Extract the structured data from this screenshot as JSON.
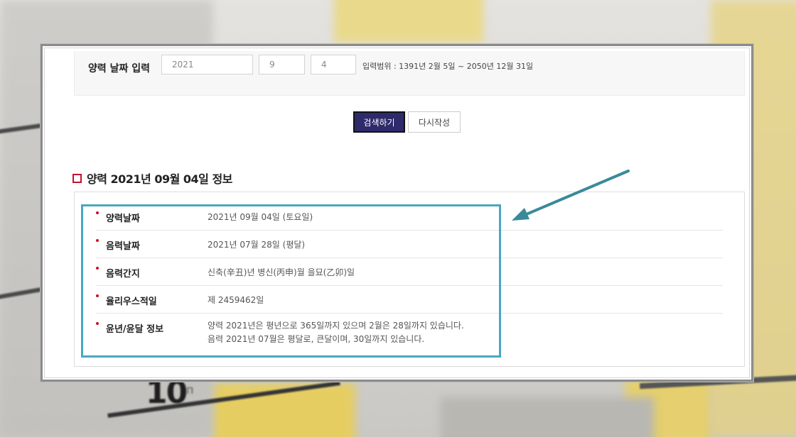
{
  "form": {
    "label": "양력 날짜 입력",
    "year_value": "2021",
    "month_value": "9",
    "day_value": "4",
    "range_text": "입력범위 : 1391년 2월 5일 ~ 2050년 12월 31일"
  },
  "buttons": {
    "search_label": "검색하기",
    "reset_label": "다시작성"
  },
  "section": {
    "title": "양력 2021년 09월 04일 정보"
  },
  "info_rows": [
    {
      "key": "양력날짜",
      "value": "2021년 09월 04일 (토요일)"
    },
    {
      "key": "음력날짜",
      "value": "2021년 07월 28일 (평달)"
    },
    {
      "key": "음력간지",
      "value": "신축(辛丑)년 병신(丙申)월 을묘(乙卯)일"
    },
    {
      "key": "율리우스적일",
      "value": "제 2459462일"
    },
    {
      "key": "윤년/윤달 정보",
      "value": "양력 2021년은 평년으로 365일까지 있으며 2월은 28일까지 있습니다.",
      "value2": "음력 2021년 07월은 평달로, 큰달이며, 30일까지 있습니다."
    }
  ],
  "background_text": {
    "big_number": "10",
    "small_mark": "п"
  },
  "colors": {
    "accent_red": "#c8102e",
    "button_navy": "#2e2a6b",
    "highlight_teal": "#4aa7c0",
    "arrow_teal": "#3a8a9a"
  }
}
